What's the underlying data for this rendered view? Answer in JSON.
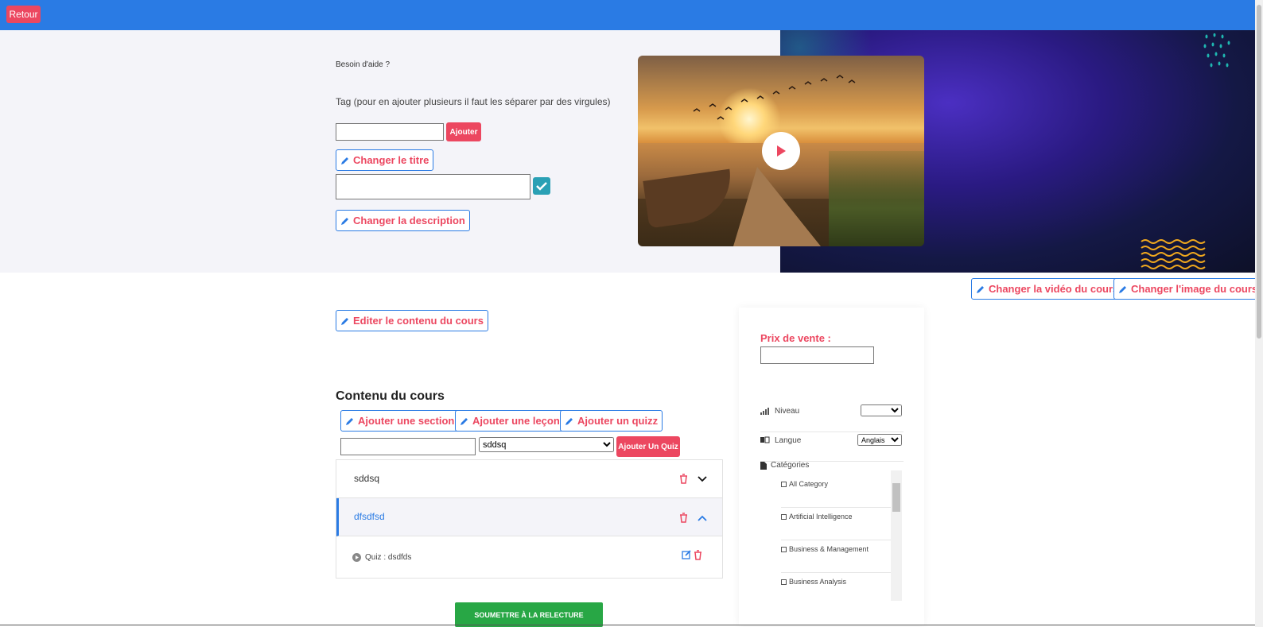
{
  "header": {
    "back_label": "Retour"
  },
  "hero": {
    "help_text": "Besoin d'aide ?",
    "tag_label": "Tag (pour en ajouter plusieurs il faut les séparer par des virgules)",
    "tag_input_value": "",
    "add_tag_label": "Ajouter",
    "change_title_label": "Changer le titre",
    "title_input_value": "",
    "change_description_label": "Changer la description"
  },
  "media": {
    "change_video_label": "Changer la vidéo du cours",
    "change_image_label": "Changer l'image du cours"
  },
  "content": {
    "edit_content_label": "Editer le contenu du cours",
    "section_title": "Contenu du cours",
    "add_section_label": "Ajouter une section",
    "add_lesson_label": "Ajouter une leçon",
    "add_quiz_label": "Ajouter un quizz",
    "quiz_input_value": "",
    "section_select_value": "sddsq",
    "add_quiz_button_label": "Ajouter Un Quiz",
    "sections": [
      {
        "label": "sddsq"
      },
      {
        "label": "dfsdfsd"
      }
    ],
    "quiz_item": "Quiz : dsdfds",
    "submit_label": "SOUMETTRE À LA RELECTURE"
  },
  "sidebar": {
    "price_label": "Prix de vente :",
    "price_value": "",
    "level_label": "Niveau",
    "level_value": "",
    "language_label": "Langue",
    "language_value": "Anglais",
    "categories_label": "Catégories",
    "categories": [
      "All Category",
      "Artificial Intelligence",
      "Business & Management",
      "Business Analysis"
    ]
  },
  "colors": {
    "primary": "#2a7be4",
    "accent": "#ec4760",
    "success": "#28a745",
    "teal": "#2aa0b5"
  }
}
